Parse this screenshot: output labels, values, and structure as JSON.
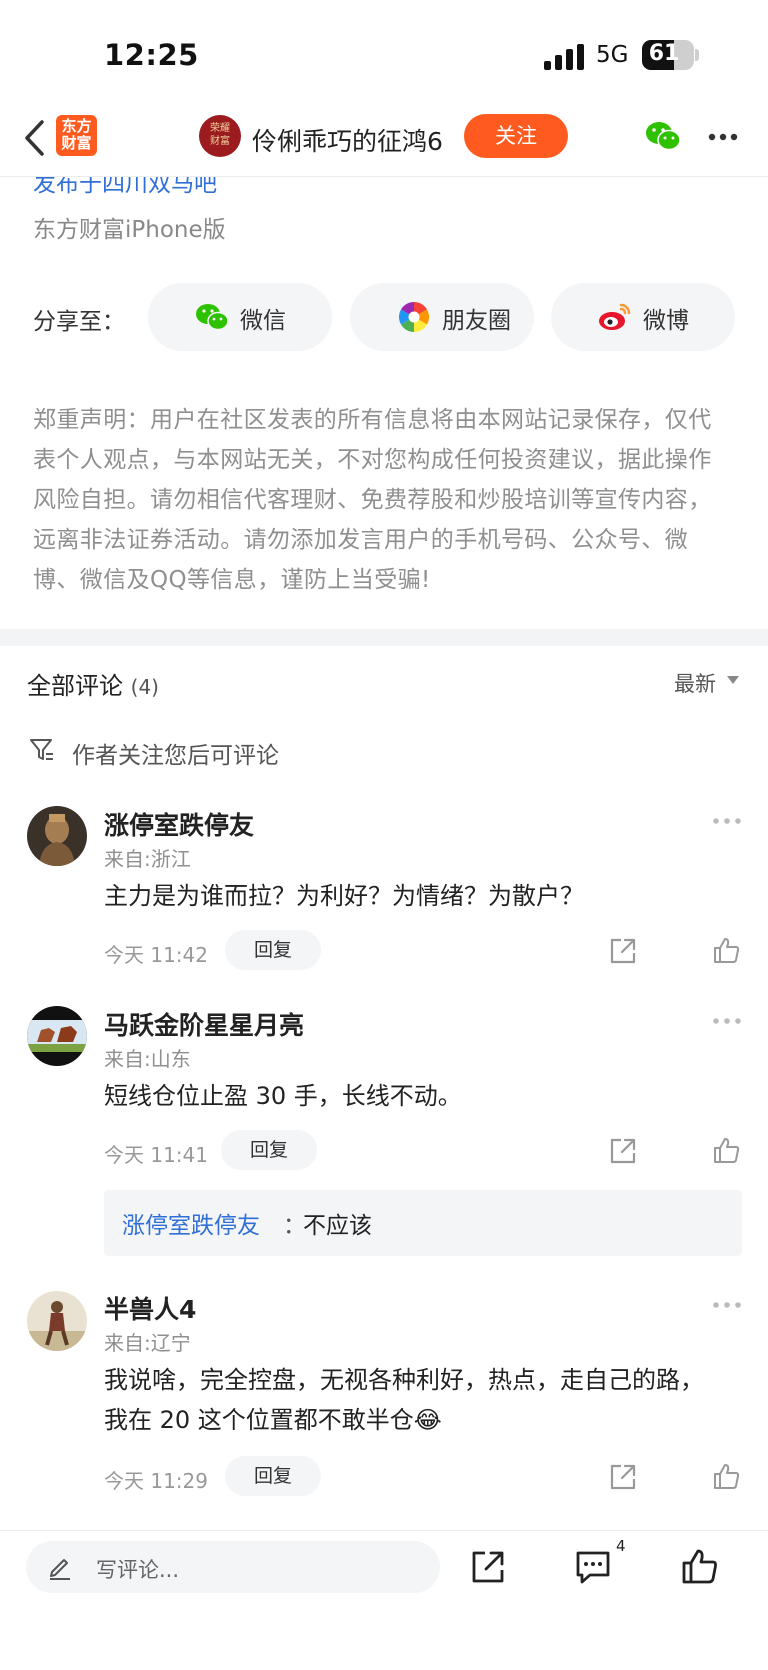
{
  "status_bar": {
    "time": "12:25",
    "network": "5G",
    "battery": "61",
    "battery_level_percent": 61
  },
  "nav": {
    "app_logo": "东方\n财富",
    "author_avatar_text": "荣耀\n财富",
    "author_name": "伶俐乖巧的征鸿6",
    "follow_label": "关注"
  },
  "post_meta": {
    "published_cut": "发布于四川双马吧",
    "platform": "东方财富iPhone版"
  },
  "share": {
    "label": "分享至：",
    "buttons": [
      {
        "label": "微信",
        "icon": "wechat-icon"
      },
      {
        "label": "朋友圈",
        "icon": "moments-icon"
      },
      {
        "label": "微博",
        "icon": "weibo-icon"
      }
    ]
  },
  "disclaimer": "郑重声明：用户在社区发表的所有信息将由本网站记录保存，仅代表个人观点，与本网站无关，不对您构成任何投资建议，据此操作风险自担。请勿相信代客理财、免费荐股和炒股培训等宣传内容，远离非法证券活动。请勿添加发言用户的手机号码、公众号、微博、微信及QQ等信息，谨防上当受骗!",
  "comments_header": {
    "title": "全部评论",
    "count": "(4)",
    "sort": "最新"
  },
  "filter_notice": "作者关注您后可评论",
  "comments": [
    {
      "name": "涨停室跌停友",
      "location": "来自:浙江",
      "text": "主力是为谁而拉？为利好？为情绪？为散户？",
      "time": "今天 11:42",
      "reply_label": "回复"
    },
    {
      "name": "马跃金阶星星月亮",
      "location": "来自:山东",
      "text": "短线仓位止盈 30 手，长线不动。",
      "time": "今天 11:41",
      "reply_label": "回复",
      "subreply": {
        "user": "涨停室跌停友",
        "sep": "：",
        "text": "不应该"
      }
    },
    {
      "name": "半兽人4",
      "location": "来自:辽宁",
      "text": "我说啥，完全控盘，无视各种利好，热点，走自己的路，我在 20 这个位置都不敢半仓😂",
      "time": "今天 11:29",
      "reply_label": "回复"
    }
  ],
  "bottom_bar": {
    "input_placeholder": "写评论...",
    "comment_count": "4"
  },
  "colors": {
    "accent": "#ff5a1f",
    "link": "#2f6fd6",
    "muted": "#8f8f8f"
  }
}
